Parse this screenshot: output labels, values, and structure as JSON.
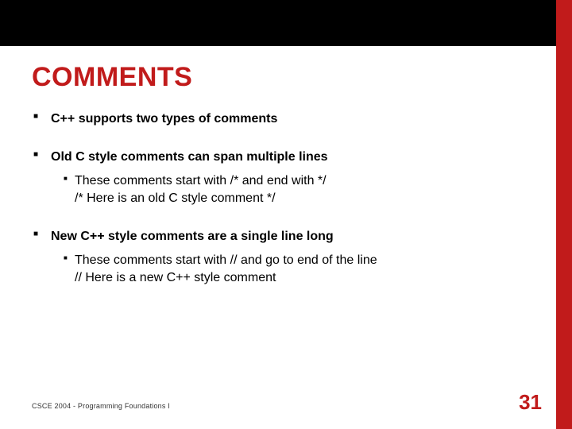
{
  "colors": {
    "accent": "#c11b1b",
    "topbar": "#000000"
  },
  "title": "COMMENTS",
  "bullets": {
    "b1": "C++ supports two types of comments",
    "b2": "Old C style comments can span multiple lines",
    "b2_sub1": "These comments start with /* and end with */",
    "b2_sub2": "/* Here is an old C style comment */",
    "b3": "New C++ style comments are a single line long",
    "b3_sub1": "These comments start with // and go to end of the line",
    "b3_sub2": "// Here is a new C++ style comment"
  },
  "footer": "CSCE 2004 - Programming Foundations I",
  "page_number": "31"
}
